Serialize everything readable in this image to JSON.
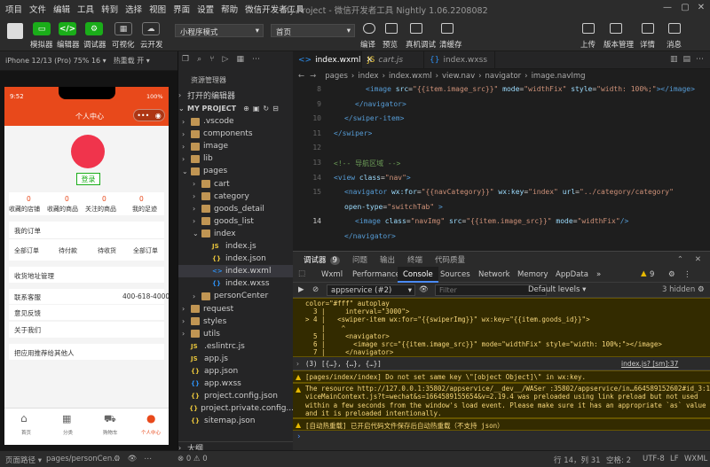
{
  "menubar": {
    "items": [
      "项目",
      "文件",
      "编辑",
      "工具",
      "转到",
      "选择",
      "视图",
      "界面",
      "设置",
      "帮助",
      "微信开发者工具"
    ],
    "title": "My Project - 微信开发者工具 Nightly 1.06.2208082"
  },
  "toolbar": {
    "buttons": [
      "模拟器",
      "编辑器",
      "调试器",
      "可视化",
      "云开发"
    ],
    "mode_select": "小程序模式",
    "page_select": "首页",
    "actions": [
      "编译",
      "预览",
      "真机调试",
      "清缓存"
    ],
    "right_actions": [
      "上传",
      "版本管理",
      "详情",
      "消息"
    ]
  },
  "simulator": {
    "device": "iPhone 12/13 (Pro) 75% 16 ▾",
    "hot_reload": "热重载 开 ▾",
    "phone": {
      "time": "9:52",
      "battery": "100%",
      "header_title": "个人中心",
      "login_button": "登录",
      "stats": [
        {
          "count": "0",
          "label": "收藏的店铺"
        },
        {
          "count": "0",
          "label": "收藏的商品"
        },
        {
          "count": "0",
          "label": "关注的商品"
        },
        {
          "count": "0",
          "label": "我的足迹"
        }
      ],
      "my_orders": "我的订单",
      "order_tabs": [
        "全部订单",
        "待付款",
        "待收货",
        "全部订单"
      ],
      "address": "收货地址管理",
      "service_label": "联系客服",
      "service_phone": "400-618-4000",
      "feedback": "意见反馈",
      "about": "关于我们",
      "recommend": "把应用推荐给其他人",
      "tabbar": [
        "首页",
        "分类",
        "购物车",
        "个人中心"
      ]
    }
  },
  "explorer": {
    "title": "资源管理器",
    "open_editors": "打开的编辑器",
    "project": "MY PROJECT",
    "tree": [
      {
        "name": ".vscode",
        "type": "folder",
        "depth": 1,
        "open": false
      },
      {
        "name": "components",
        "type": "folder",
        "depth": 1,
        "open": false
      },
      {
        "name": "image",
        "type": "folder",
        "depth": 1,
        "open": false
      },
      {
        "name": "lib",
        "type": "folder",
        "depth": 1,
        "open": false
      },
      {
        "name": "pages",
        "type": "folder",
        "depth": 1,
        "open": true
      },
      {
        "name": "cart",
        "type": "folder",
        "depth": 2,
        "open": false
      },
      {
        "name": "category",
        "type": "folder",
        "depth": 2,
        "open": false
      },
      {
        "name": "goods_detail",
        "type": "folder",
        "depth": 2,
        "open": false
      },
      {
        "name": "goods_list",
        "type": "folder",
        "depth": 2,
        "open": false
      },
      {
        "name": "index",
        "type": "folder",
        "depth": 2,
        "open": true
      },
      {
        "name": "index.js",
        "type": "js",
        "depth": 3
      },
      {
        "name": "index.json",
        "type": "json",
        "depth": 3
      },
      {
        "name": "index.wxml",
        "type": "wxml",
        "depth": 3,
        "selected": true
      },
      {
        "name": "index.wxss",
        "type": "wxss",
        "depth": 3
      },
      {
        "name": "personCenter",
        "type": "folder",
        "depth": 2,
        "open": false
      },
      {
        "name": "request",
        "type": "folder",
        "depth": 1,
        "open": false
      },
      {
        "name": "styles",
        "type": "folder",
        "depth": 1,
        "open": false
      },
      {
        "name": "utils",
        "type": "folder",
        "depth": 1,
        "open": false
      },
      {
        "name": ".eslintrc.js",
        "type": "js",
        "depth": 1
      },
      {
        "name": "app.js",
        "type": "js",
        "depth": 1
      },
      {
        "name": "app.json",
        "type": "json",
        "depth": 1
      },
      {
        "name": "app.wxss",
        "type": "wxss",
        "depth": 1
      },
      {
        "name": "project.config.json",
        "type": "json",
        "depth": 1
      },
      {
        "name": "project.private.config...",
        "type": "json",
        "depth": 1
      },
      {
        "name": "sitemap.json",
        "type": "json",
        "depth": 1
      }
    ],
    "outline": "大纲"
  },
  "editor": {
    "tabs": [
      "index.wxml",
      "cart.js",
      "index.wxss"
    ],
    "breadcrumb": [
      "pages",
      "index",
      "index.wxml",
      "view.nav",
      "navigator",
      "image.navImg"
    ],
    "lines": [
      {
        "n": "",
        "parts": [
          [
            "tg",
            "<image "
          ],
          [
            "at",
            "src"
          ],
          [
            "tx",
            "="
          ],
          [
            "st",
            "\"{{item.image_src}}\""
          ],
          [
            "at",
            " mode"
          ],
          [
            "tx",
            "="
          ],
          [
            "st",
            "\"widthFix\""
          ],
          [
            "at",
            " style"
          ],
          [
            "tx",
            "="
          ],
          [
            "st",
            "\"width: 100%;\""
          ],
          [
            "tg",
            "></image>"
          ]
        ],
        "indent": 3
      },
      {
        "n": "",
        "parts": [
          [
            "tg",
            "</navigator>"
          ]
        ],
        "indent": 2
      },
      {
        "n": "",
        "parts": [
          [
            "tg",
            "</swiper-item>"
          ]
        ],
        "indent": 1
      },
      {
        "n": "",
        "parts": [
          [
            "tg",
            "</swiper>"
          ]
        ],
        "indent": 0
      },
      {
        "n": "",
        "parts": [],
        "indent": 0
      },
      {
        "n": "",
        "parts": [
          [
            "cm",
            "<!-- 导航区域 -->"
          ]
        ],
        "indent": 0
      },
      {
        "n": "",
        "parts": [
          [
            "tg",
            "<view "
          ],
          [
            "at",
            "class"
          ],
          [
            "tx",
            "="
          ],
          [
            "st",
            "\"nav\""
          ],
          [
            "tg",
            ">"
          ]
        ],
        "indent": 0
      },
      {
        "n": "",
        "parts": [
          [
            "tg",
            "<navigator "
          ],
          [
            "at",
            "wx:for"
          ],
          [
            "tx",
            "="
          ],
          [
            "st",
            "\"{{navCategory}}\""
          ],
          [
            "at",
            " wx:key"
          ],
          [
            "tx",
            "="
          ],
          [
            "st",
            "\"index\""
          ],
          [
            "at",
            " url"
          ],
          [
            "tx",
            "="
          ],
          [
            "st",
            "\"../category/category\""
          ]
        ],
        "indent": 1
      },
      {
        "n": "",
        "parts": [
          [
            "at",
            "open-type"
          ],
          [
            "tx",
            "="
          ],
          [
            "st",
            "\"switchTab\""
          ],
          [
            "tg",
            " >"
          ]
        ],
        "indent": 1
      },
      {
        "n": "14",
        "parts": [
          [
            "tg",
            "<image "
          ],
          [
            "at",
            "class"
          ],
          [
            "tx",
            "="
          ],
          [
            "st",
            "\"navImg\""
          ],
          [
            "at",
            " src"
          ],
          [
            "tx",
            "="
          ],
          [
            "st",
            "\"{{item.image_src}}\""
          ],
          [
            "at",
            " mode"
          ],
          [
            "tx",
            "="
          ],
          [
            "st",
            "\"widthFix\""
          ],
          [
            "tg",
            "/>"
          ]
        ],
        "indent": 2
      },
      {
        "n": "",
        "parts": [
          [
            "tg",
            "</navigator>"
          ]
        ],
        "indent": 1
      }
    ],
    "line_numbers": [
      "8",
      "9",
      "10",
      "11",
      "12",
      "13",
      "",
      "14",
      "",
      ""
    ]
  },
  "devtools": {
    "top_tabs": [
      {
        "label": "调试器",
        "badge": "9"
      },
      {
        "label": "问题"
      },
      {
        "label": "输出"
      },
      {
        "label": "终端"
      },
      {
        "label": "代码质量"
      }
    ],
    "panel_tabs": [
      "Wxml",
      "Performance",
      "Console",
      "Sources",
      "Network",
      "Memory",
      "AppData"
    ],
    "warn_count": "9",
    "context": "appservice (#2)",
    "filter_placeholder": "Filter",
    "levels": "Default levels",
    "hidden": "3 hidden",
    "console_lines": [
      "color=\"#fff\" autoplay",
      "  3 |     interval=\"3000\">",
      "> 4 |   <swiper-item wx:for=\"{{swiperImg}}\" wx:key=\"{{item.goods_id}}\">",
      "    |    ^",
      "  5 |     <navigator>",
      "  6 |       <image src=\"{{item.image_src}}\" mode=\"widthFix\" style=\"width: 100%;\"></image>",
      "  7 |     </navigator>"
    ],
    "array_line": "(3) [{…}, {…}, {…}]",
    "array_src": "index.js? [sm]:37",
    "warn1": "[pages/index/index] Do not set same key \\\"[object Object]\\\" in wx:key.",
    "warn2_lines": [
      "The resource http://127.0.0.1:35802/appservice/__dev__/WASer :35802/appservice/in…664589152602#id_3:1",
      "viceMainContext.js?t=wechat&s=1664589155654&v=2.19.4 was preloaded using link preload but not used",
      "within a few seconds from the window's load event. Please make sure it has an appropriate `as` value",
      "and it is preloaded intentionally."
    ],
    "warn3": "[自动热重载] 已开启代码文件保存后自动热重载（不支持 json）",
    "prompt": "›"
  },
  "statusbar": {
    "left": [
      "页面路径 ▾",
      "pages/personCen…"
    ],
    "right": [
      "行 14，列 31",
      "空格: 2",
      "UTF-8",
      "LF",
      "WXML"
    ]
  },
  "colors": {
    "accent_green": "#1aad19",
    "header_red": "#e8491b",
    "avatar_red": "#f0344c"
  }
}
